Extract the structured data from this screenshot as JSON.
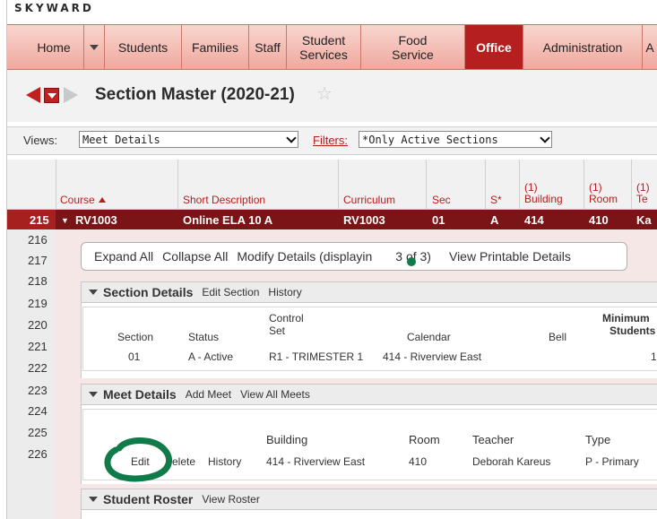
{
  "app": {
    "logo": "SKYWARD"
  },
  "nav": {
    "items": [
      {
        "label": "Home"
      },
      {
        "label": "Students"
      },
      {
        "label": "Families"
      },
      {
        "label": "Staff"
      },
      {
        "label": "Student Services"
      },
      {
        "label": "Food Service"
      },
      {
        "label": "Office",
        "active": true
      },
      {
        "label": "Administration"
      },
      {
        "label": "A"
      }
    ],
    "accent_color": "#b51f1f"
  },
  "page": {
    "title": "Section Master (2020-21)",
    "favorite_icon": "star-icon"
  },
  "views": {
    "label": "Views:",
    "selected": "Meet Details",
    "filters_label": "Filters:",
    "filter_selected": "*Only Active Sections"
  },
  "grid": {
    "headers": {
      "course": "Course",
      "short_description": "Short Description",
      "curriculum": "Curriculum",
      "sec": "Sec",
      "s": "S*",
      "building_num": "(1)",
      "building": "Building",
      "room_num": "(1)",
      "room": "Room",
      "teacher_num": "(1)",
      "teacher": "Te"
    },
    "selected_row": {
      "num": "215",
      "course": "RV1003",
      "short_description": "Online ELA 10 A",
      "curriculum": "RV1003",
      "sec": "01",
      "s": "A",
      "building": "414",
      "room": "410",
      "teacher": "Ka"
    },
    "row_numbers": [
      "216",
      "217",
      "218",
      "219",
      "220",
      "221",
      "222",
      "223",
      "224",
      "225",
      "226"
    ]
  },
  "detail": {
    "links": {
      "expand_all": "Expand All",
      "collapse_all": "Collapse All",
      "modify_details": "Modify Details (displayin",
      "modify_details_tail": "3 of 3)",
      "view_printable": "View Printable Details"
    },
    "section_details": {
      "title": "Section Details",
      "edit": "Edit Section",
      "history": "History",
      "headers": {
        "section": "Section",
        "status": "Status",
        "control": "Control",
        "set": "Set",
        "calendar": "Calendar",
        "bell": "Bell",
        "minimum": "Minimum",
        "students": "Students"
      },
      "values": {
        "section": "01",
        "status": "A - Active",
        "control_set": "R1 - TRIMESTER 1",
        "calendar": "414 - Riverview East",
        "minimum": "1"
      }
    },
    "meet_details": {
      "title": "Meet Details",
      "add": "Add Meet",
      "view_all": "View All Meets",
      "headers": {
        "building": "Building",
        "room": "Room",
        "teacher": "Teacher",
        "type": "Type"
      },
      "row": {
        "edit": "Edit",
        "delete": "elete",
        "history": "History",
        "building": "414 - Riverview East",
        "room": "410",
        "teacher": "Deborah Kareus",
        "type": "P - Primary"
      }
    },
    "student_roster": {
      "title": "Student Roster",
      "view": "View Roster"
    }
  }
}
